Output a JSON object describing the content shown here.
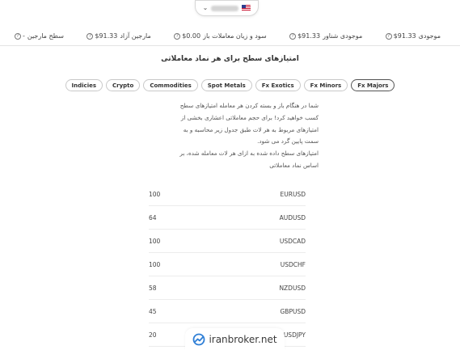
{
  "header": {
    "flag": "us-flag-icon"
  },
  "stats": [
    {
      "label": "موجودی",
      "value": "$91.33"
    },
    {
      "label": "موجودی شناور",
      "value": "$91.33"
    },
    {
      "label": "سود و زیان معاملات باز",
      "value": "$0.00"
    },
    {
      "label": "مارجین آزاد",
      "value": "$91.33"
    },
    {
      "label": "سطح مارجین",
      "value": "-"
    }
  ],
  "page": {
    "title": "امتیازهای سطح برای هر نماد معاملاتی"
  },
  "tabs": [
    "Fx Majors",
    "Fx Minors",
    "Fx Exotics",
    "Spot Metals",
    "Commodities",
    "Crypto",
    "Indicies"
  ],
  "active_tab": "Fx Majors",
  "description": {
    "lines": [
      "شما در هنگام باز و بسته کردن هر معامله امتیازهای سطح",
      "کسب خواهید کرد! برای حجم معاملاتی اعشاری بخشی از",
      "امتیازهای مربوط به هر لات طبق جدول زیر محاسبه و به",
      "سمت پایین گرد می شود.",
      "امتیازهای سطح داده شده به ازای هر لات معامله شده، بر",
      "اساس نماد معاملاتی"
    ]
  },
  "table": {
    "rows": [
      {
        "symbol": "EURUSD",
        "points": "100"
      },
      {
        "symbol": "AUDUSD",
        "points": "64"
      },
      {
        "symbol": "USDCAD",
        "points": "100"
      },
      {
        "symbol": "USDCHF",
        "points": "100"
      },
      {
        "symbol": "NZDUSD",
        "points": "58"
      },
      {
        "symbol": "GBPUSD",
        "points": "45"
      },
      {
        "symbol": "USDJPY",
        "points": "20"
      }
    ]
  },
  "watermark": {
    "text": "iranbroker.net"
  },
  "colors": {
    "accent": "#2f7fd6",
    "text": "#333333",
    "border": "#c9c9c9"
  }
}
